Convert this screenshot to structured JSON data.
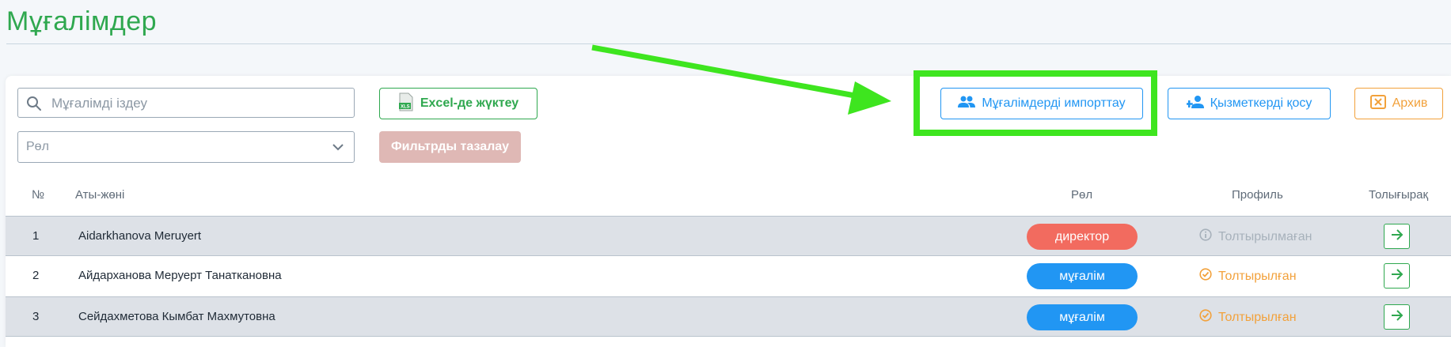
{
  "page": {
    "title": "Мұғалімдер"
  },
  "toolbar": {
    "search_placeholder": "Мұғалімді іздеу",
    "role_select_value": "Рөл",
    "excel_label": "Excel-де жүктеу",
    "clear_filters_label": "Фильтрды тазалау",
    "import_label": "Мұғалімдерді импорттау",
    "add_staff_label": "Қызметкерді қосу",
    "archive_label": "Архив"
  },
  "colors": {
    "brand_green": "#2fa84f",
    "primary_blue": "#2196f3",
    "archive_orange": "#f2a13b",
    "director_red": "#f26b5f",
    "annotation_green": "#3ee51f"
  },
  "table": {
    "headers": {
      "num": "№",
      "name": "Аты-жөні",
      "role": "Рөл",
      "profile": "Профиль",
      "details": "Толығырақ"
    },
    "rows": [
      {
        "num": "1",
        "name": "Aidarkhanova Meruyert",
        "role": "директор",
        "role_color": "#f26b5f",
        "status": "Толтырылмаған",
        "status_kind": "info",
        "status_color": "#a7b1bb"
      },
      {
        "num": "2",
        "name": "Айдарханова Меруерт Танаткановна",
        "role": "мұғалім",
        "role_color": "#2196f3",
        "status": "Толтырылған",
        "status_kind": "done",
        "status_color": "#f2a13b"
      },
      {
        "num": "3",
        "name": "Сейдахметова Кымбат Махмутовна",
        "role": "мұғалім",
        "role_color": "#2196f3",
        "status": "Толтырылған",
        "status_kind": "done",
        "status_color": "#f2a13b"
      }
    ]
  },
  "icons": {
    "search": "search-icon",
    "chevron": "chevron-down-icon",
    "excel": "xls-file-icon",
    "import": "people-icon",
    "add_staff": "person-add-icon",
    "archive": "close-box-icon",
    "info": "info-circle-icon",
    "done": "check-circle-icon",
    "open": "arrow-right-icon"
  }
}
